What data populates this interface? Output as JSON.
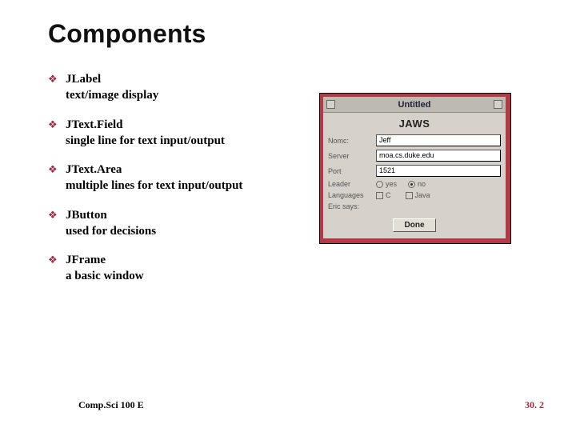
{
  "title": "Components",
  "bullets": [
    {
      "term": "JLabel",
      "desc": "text/image display"
    },
    {
      "term": "JText.Field",
      "desc": "single line for text input/output"
    },
    {
      "term": "JText.Area",
      "desc": "multiple lines for text input/output"
    },
    {
      "term": "JButton",
      "desc": "used for decisions"
    },
    {
      "term": "JFrame",
      "desc": "a basic window"
    }
  ],
  "window": {
    "titlebar": "Untitled",
    "heading": "JAWS",
    "rows": {
      "name_label": "Nomc:",
      "name_value": "Jeff",
      "server_label": "Server",
      "server_value": "moa.cs.duke.edu",
      "port_label": "Port",
      "port_value": "1521",
      "leader_label": "Leader",
      "radio_yes": "yes",
      "radio_no": "no",
      "lang_label": "Languages",
      "cb1": "C",
      "cb2": "Java",
      "says_label": "Eric says:"
    },
    "button": "Done"
  },
  "footer": {
    "left": "Comp.Sci 100 E",
    "right": "30. 2"
  }
}
